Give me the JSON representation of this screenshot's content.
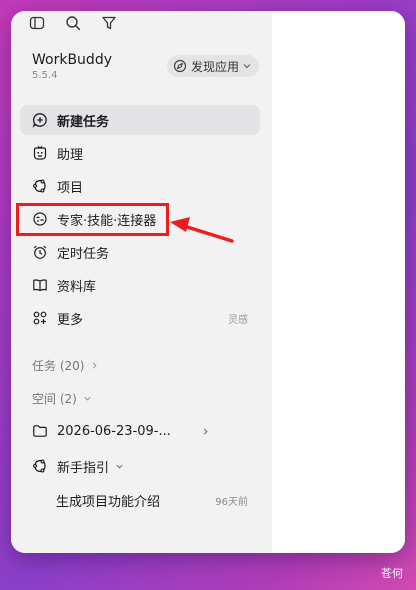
{
  "app": {
    "name": "WorkBuddy",
    "version": "5.5.4"
  },
  "discover_label": "发现应用",
  "nav": [
    {
      "label": "新建任务"
    },
    {
      "label": "助理"
    },
    {
      "label": "项目"
    },
    {
      "label": "专家·技能·连接器"
    },
    {
      "label": "定时任务"
    },
    {
      "label": "资料库"
    },
    {
      "label": "更多",
      "hint": "灵感"
    }
  ],
  "sections": {
    "tasks": "任务 (20)",
    "spaces": "空间 (2)"
  },
  "space_item": "2026-06-23-09-...",
  "guide": {
    "label": "新手指引",
    "child": "生成项目功能介绍",
    "child_time": "96天前"
  },
  "watermark": "苍何",
  "colors": {
    "highlight": "#ee1c1c",
    "sidebar_bg": "#f2f2f3"
  }
}
